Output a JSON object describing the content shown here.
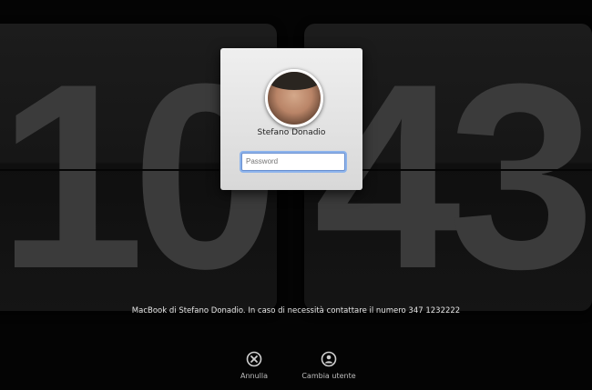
{
  "clock": {
    "hours": "10",
    "minutes": "43"
  },
  "login": {
    "user_name": "Stefano Donadio",
    "password_placeholder": "Password"
  },
  "message": "MacBook di Stefano Donadio. In caso di necessità contattare il numero 347 1232222",
  "actions": {
    "cancel_label": "Annulla",
    "switch_user_label": "Cambia utente"
  },
  "colors": {
    "background": "#040404",
    "focus_ring": "#8db4ec",
    "digit": "#3b3b3b"
  },
  "icons": {
    "cancel": "x-circle-icon",
    "switch_user": "person-circle-icon"
  }
}
